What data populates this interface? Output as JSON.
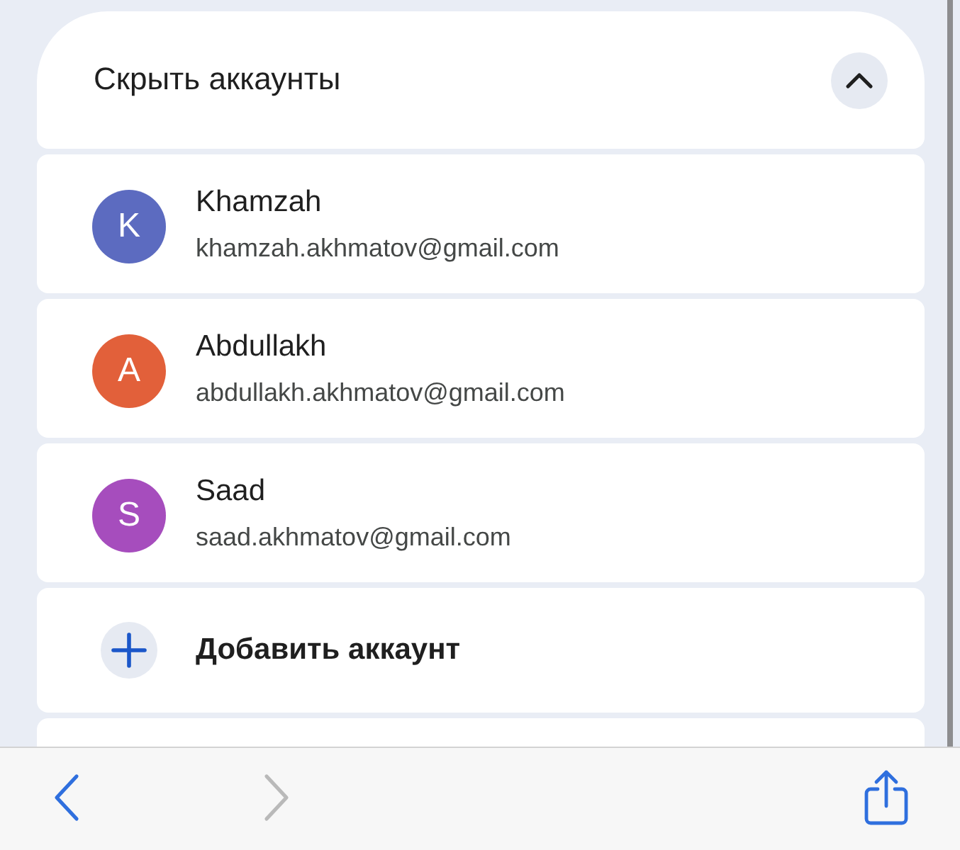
{
  "header": {
    "title": "Скрыть аккаунты",
    "expanded": true
  },
  "accounts": [
    {
      "initial": "K",
      "name": "Khamzah",
      "email": "khamzah.akhmatov@gmail.com",
      "color": "#5c6bc0"
    },
    {
      "initial": "A",
      "name": "Abdullakh",
      "email": "abdullakh.akhmatov@gmail.com",
      "color": "#e2603a"
    },
    {
      "initial": "S",
      "name": "Saad",
      "email": "saad.akhmatov@gmail.com",
      "color": "#a64dbd"
    }
  ],
  "add_account": {
    "label": "Добавить аккаунт"
  },
  "toolbar": {
    "items": [
      {
        "kind": "back",
        "disabled": false
      },
      {
        "kind": "forward",
        "disabled": true
      },
      {
        "kind": "share",
        "disabled": false
      }
    ]
  }
}
